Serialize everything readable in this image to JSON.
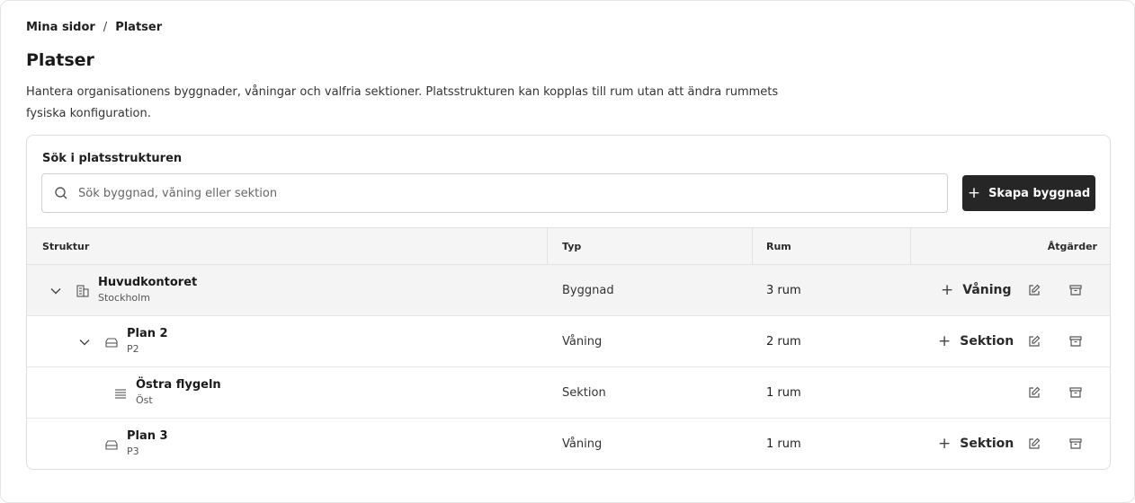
{
  "breadcrumb": {
    "items": [
      "Mina sidor",
      "Platser"
    ],
    "separator": "/"
  },
  "page": {
    "title": "Platser",
    "description": "Hantera organisationens byggnader, våningar och valfria sektioner. Platsstrukturen kan kopplas till rum utan att ändra rummets fysiska konfiguration."
  },
  "search": {
    "label": "Sök i platsstrukturen",
    "placeholder": "Sök byggnad, våning eller sektion",
    "value": ""
  },
  "create_button": {
    "label": "Skapa byggnad",
    "icon": "plus-icon"
  },
  "table": {
    "headers": {
      "structure": "Struktur",
      "type": "Typ",
      "rooms": "Rum",
      "actions": "Åtgärder"
    },
    "rows": [
      {
        "name": "Huvudkontoret",
        "sub": "Stockholm",
        "type": "Byggnad",
        "rooms": "3 rum",
        "add_label": "Våning",
        "icon": "building-icon",
        "expanded": true
      },
      {
        "name": "Plan 2",
        "sub": "P2",
        "type": "Våning",
        "rooms": "2 rum",
        "add_label": "Sektion",
        "icon": "floor-icon",
        "expanded": true
      },
      {
        "name": "Östra flygeln",
        "sub": "Öst",
        "type": "Sektion",
        "rooms": "1 rum",
        "add_label": "",
        "icon": "section-icon"
      },
      {
        "name": "Plan 3",
        "sub": "P3",
        "type": "Våning",
        "rooms": "1 rum",
        "add_label": "Sektion",
        "icon": "floor-icon"
      }
    ]
  },
  "colors": {
    "primary_button": "#262626",
    "header_bg": "#f5f5f5",
    "border": "#e2e2e2"
  }
}
